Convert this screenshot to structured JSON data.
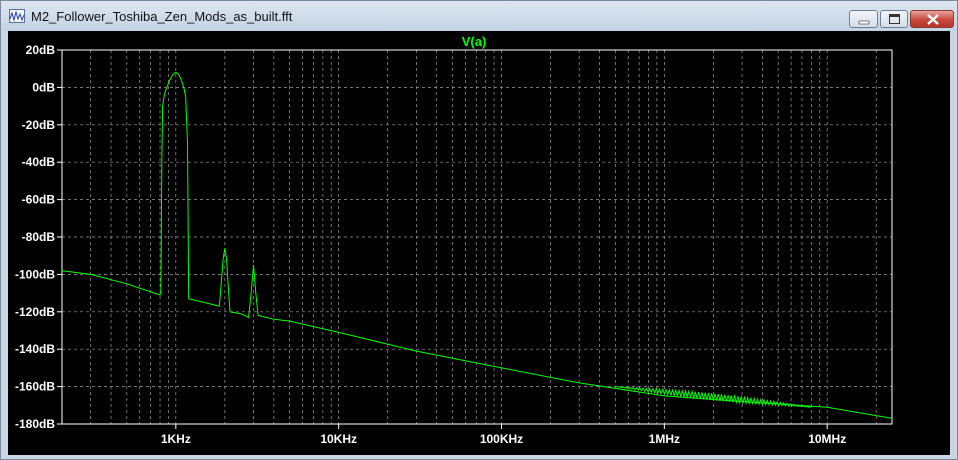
{
  "window": {
    "title": "M2_Follower_Toshiba_Zen_Mods_as_built.fft",
    "icons": {
      "app": "waveform-app-icon",
      "minimize": "minimize-icon",
      "maximize": "maximize-icon",
      "close": "close-icon"
    }
  },
  "colors": {
    "background": "#000000",
    "trace": "#00ff00",
    "grid": "#9a9a9a",
    "axis_text": "#ffffff"
  },
  "chart_data": {
    "type": "line",
    "title": "V(a)",
    "xscale": "log",
    "xlim": [
      200,
      25000000
    ],
    "ylim": [
      -180,
      20
    ],
    "grid": true,
    "x_ticks": [
      {
        "value": 1000,
        "label": "1KHz"
      },
      {
        "value": 10000,
        "label": "10KHz"
      },
      {
        "value": 100000,
        "label": "100KHz"
      },
      {
        "value": 1000000,
        "label": "1MHz"
      },
      {
        "value": 10000000,
        "label": "10MHz"
      }
    ],
    "y_ticks": [
      {
        "value": 20,
        "label": "20dB"
      },
      {
        "value": 0,
        "label": "0dB"
      },
      {
        "value": -20,
        "label": "-20dB"
      },
      {
        "value": -40,
        "label": "-40dB"
      },
      {
        "value": -60,
        "label": "-60dB"
      },
      {
        "value": -80,
        "label": "-80dB"
      },
      {
        "value": -100,
        "label": "-100dB"
      },
      {
        "value": -120,
        "label": "-120dB"
      },
      {
        "value": -140,
        "label": "-140dB"
      },
      {
        "value": -160,
        "label": "-160dB"
      },
      {
        "value": -180,
        "label": "-180dB"
      }
    ],
    "series": [
      {
        "name": "V(a)",
        "color": "#00ff00",
        "points": [
          [
            200,
            -98
          ],
          [
            300,
            -100
          ],
          [
            500,
            -105
          ],
          [
            800,
            -111
          ],
          [
            810,
            -110
          ],
          [
            820,
            -40
          ],
          [
            830,
            -10
          ],
          [
            850,
            -4
          ],
          [
            880,
            0
          ],
          [
            920,
            4
          ],
          [
            960,
            7
          ],
          [
            1000,
            8
          ],
          [
            1040,
            7
          ],
          [
            1080,
            4
          ],
          [
            1120,
            0
          ],
          [
            1150,
            -5
          ],
          [
            1180,
            -30
          ],
          [
            1200,
            -113
          ],
          [
            1500,
            -115
          ],
          [
            1850,
            -117
          ],
          [
            1900,
            -105
          ],
          [
            1950,
            -92
          ],
          [
            2000,
            -86
          ],
          [
            2050,
            -92
          ],
          [
            2100,
            -107
          ],
          [
            2150,
            -120
          ],
          [
            2500,
            -121
          ],
          [
            2800,
            -123
          ],
          [
            2900,
            -110
          ],
          [
            3000,
            -95
          ],
          [
            3100,
            -110
          ],
          [
            3200,
            -122
          ],
          [
            4000,
            -124
          ],
          [
            5000,
            -125
          ],
          [
            10000,
            -131
          ],
          [
            30000,
            -141
          ],
          [
            100000,
            -150
          ],
          [
            300000,
            -158
          ],
          [
            1000000,
            -165
          ],
          [
            3000000,
            -168
          ],
          [
            10000000,
            -171
          ],
          [
            25000000,
            -177
          ]
        ]
      }
    ]
  }
}
